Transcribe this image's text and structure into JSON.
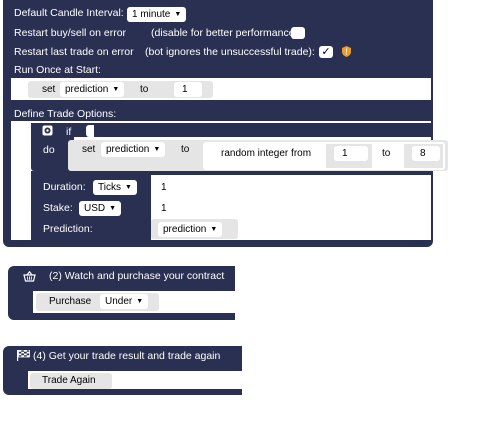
{
  "trade_params": {
    "candle_interval_label": "Default Candle Interval:",
    "candle_interval_value": "1 minute",
    "restart_buysell_label": "Restart buy/sell on error",
    "restart_buysell_hint": "(disable for better performance):",
    "restart_buysell_checked": false,
    "restart_last_label": "Restart last trade on error",
    "restart_last_hint": "(bot ignores the unsuccessful trade):",
    "restart_last_checked": true,
    "restart_last_check_glyph": "✓",
    "run_once_label": "Run Once at Start:",
    "run_once_set": "set",
    "run_once_var": "prediction",
    "run_once_to": "to",
    "run_once_value": "1",
    "define_label": "Define Trade Options:",
    "if_label": "if",
    "do_label": "do",
    "do_set": "set",
    "do_var": "prediction",
    "do_to": "to",
    "random_label": "random integer from",
    "random_from": "1",
    "random_to_label": "to",
    "random_to": "8",
    "duration_label": "Duration:",
    "duration_unit": "Ticks",
    "duration_value": "1",
    "stake_label": "Stake:",
    "stake_currency": "USD",
    "stake_value": "1",
    "prediction_label": "Prediction:",
    "prediction_value": "prediction"
  },
  "purchase_block": {
    "title": "(2) Watch and purchase your contract",
    "purchase_label": "Purchase",
    "purchase_value": "Under"
  },
  "after_block": {
    "title": "(4) Get your trade result and trade again",
    "trade_again_label": "Trade Again"
  },
  "colors": {
    "block_navy": "#2a3052",
    "input_gray": "#e5e5e5",
    "warning_orange": "#f09b2a"
  },
  "icons": [
    "gear-icon",
    "basket-icon",
    "checkered-flag-icon",
    "warning-shield-icon",
    "dropdown-caret-icon"
  ]
}
